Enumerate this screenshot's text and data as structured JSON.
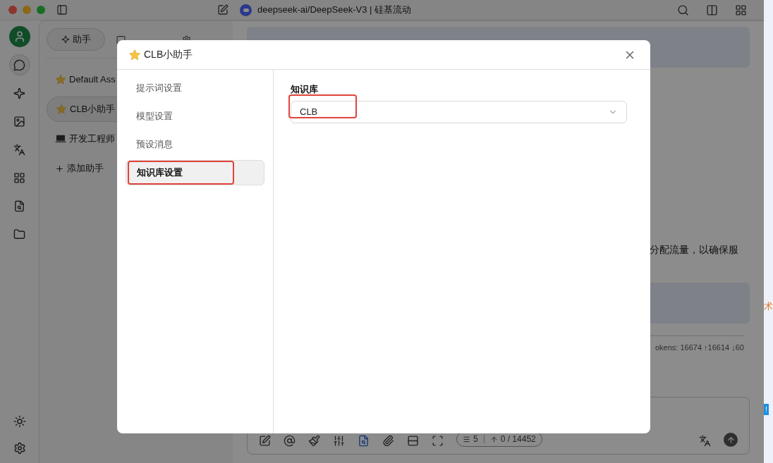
{
  "title_bar": {
    "title": "deepseek-ai/DeepSeek-V3 | 硅基流动"
  },
  "nav_rail": [
    {
      "selected": false
    },
    {
      "selected": true
    },
    {
      "selected": false
    },
    {
      "selected": false
    },
    {
      "selected": false
    },
    {
      "selected": false
    },
    {
      "selected": false
    },
    {
      "selected": false
    }
  ],
  "assistants_panel": {
    "tabs": [
      {
        "label": "助手",
        "selected": true
      }
    ],
    "items": [
      {
        "kind": "star",
        "name": "Default Ass",
        "selected": false
      },
      {
        "kind": "star",
        "name": "CLB小助手",
        "selected": true
      },
      {
        "kind": "laptop",
        "name": "开发工程师",
        "selected": false
      }
    ],
    "add_label": "添加助手"
  },
  "chat": {
    "message_text": "分配流量，以确保服",
    "token_info": "okens: 16674 ↑16614 ↓60"
  },
  "input_bar": {
    "context_count": "5",
    "token_count": "0 / 14452"
  },
  "side_strip": {
    "text": "术",
    "badge": "!"
  },
  "modal": {
    "title": "CLB小助手",
    "nav": [
      {
        "label": "提示词设置",
        "selected": false,
        "annotated": false
      },
      {
        "label": "模型设置",
        "selected": false,
        "annotated": false
      },
      {
        "label": "预设消息",
        "selected": false,
        "annotated": false
      },
      {
        "label": "知识库设置",
        "selected": true,
        "annotated": true
      }
    ],
    "field_label": "知识库",
    "select_value": "CLB",
    "select_annotated": true
  }
}
